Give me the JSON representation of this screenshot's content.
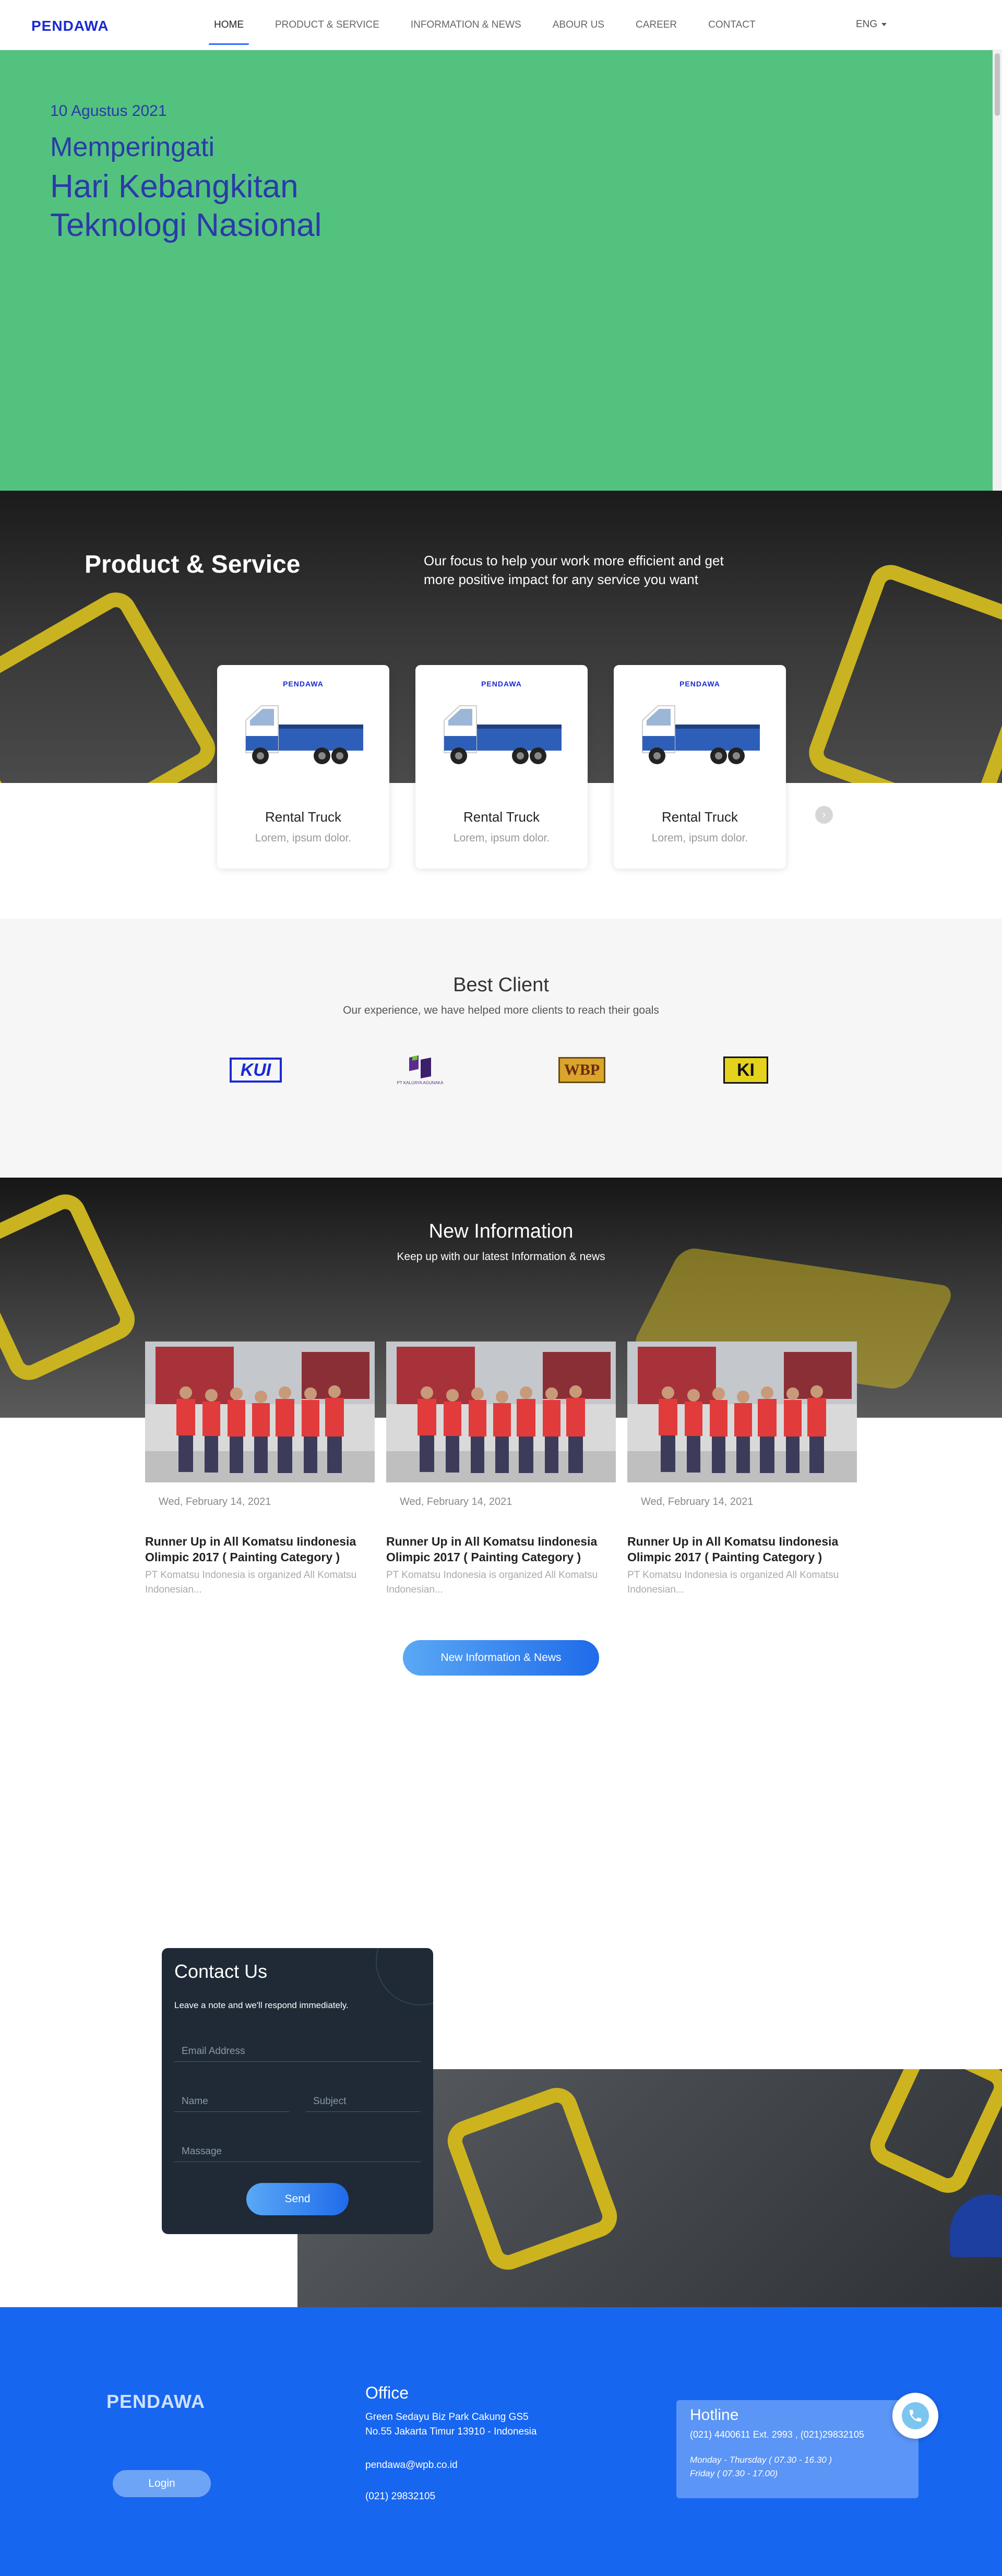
{
  "brand": {
    "logo_text": "PENDAWA"
  },
  "nav": {
    "items": [
      {
        "label": "HOME",
        "active": true
      },
      {
        "label": "PRODUCT & SERVICE",
        "active": false
      },
      {
        "label": "INFORMATION & NEWS",
        "active": false
      },
      {
        "label": "ABOUR US",
        "active": false
      },
      {
        "label": "CAREER",
        "active": false
      },
      {
        "label": "CONTACT",
        "active": false
      }
    ],
    "language": "ENG"
  },
  "hero": {
    "date": "10 Agustus 2021",
    "line1": "Memperingati",
    "line2": "Hari Kebangkitan",
    "line3": "Teknologi Nasional",
    "bg_color": "#53c27f",
    "text_color": "#2b3aa8"
  },
  "product": {
    "title": "Product & Service",
    "description": "Our focus to help your work more efficient and get more positive impact for any service you want",
    "cards": [
      {
        "brand": "PENDAWA",
        "title": "Rental Truck",
        "subtitle": "Lorem, ipsum dolor."
      },
      {
        "brand": "PENDAWA",
        "title": "Rental Truck",
        "subtitle": "Lorem, ipsum dolor."
      },
      {
        "brand": "PENDAWA",
        "title": "Rental Truck",
        "subtitle": "Lorem, ipsum dolor."
      }
    ]
  },
  "clients": {
    "title": "Best Client",
    "subtitle": "Our experience, we have helped more clients to reach their goals",
    "logos": [
      {
        "text": "KUI"
      },
      {
        "text": "PT KALIJAYA AGUNAKA"
      },
      {
        "text": "WBP"
      },
      {
        "text": "KI"
      }
    ]
  },
  "news": {
    "title": "New Information",
    "subtitle": "Keep up with our latest Information & news",
    "items": [
      {
        "date": "Wed, February 14, 2021",
        "headline": "Runner Up in All Komatsu Iindonesia Olimpic 2017 ( Painting Category )",
        "excerpt": "PT Komatsu Indonesia is organized All Komatsu Indonesian..."
      },
      {
        "date": "Wed, February 14, 2021",
        "headline": "Runner Up in All Komatsu Iindonesia Olimpic 2017 ( Painting Category )",
        "excerpt": "PT Komatsu Indonesia is organized All Komatsu Indonesian..."
      },
      {
        "date": "Wed, February 14, 2021",
        "headline": "Runner Up in All Komatsu Iindonesia Olimpic 2017 ( Painting Category )",
        "excerpt": "PT Komatsu Indonesia is organized All Komatsu Indonesian..."
      }
    ],
    "button_label": "New Information & News"
  },
  "contact": {
    "title": "Contact Us",
    "note": "Leave a note and we'll respond immediately.",
    "email_placeholder": "Email Address",
    "name_placeholder": "Name",
    "subject_placeholder": "Subject",
    "message_placeholder": "Massage",
    "send_label": "Send"
  },
  "footer": {
    "logo_text": "PENDAWA",
    "login_label": "Login",
    "office_title": "Office",
    "address_line1": "Green Sedayu Biz Park Cakung GS5",
    "address_line2": "No.55 Jakarta Timur 13910 - Indonesia",
    "email": "pendawa@wpb.co.id",
    "phone": "(021) 29832105",
    "hotline_title": "Hotline",
    "hotline_numbers": "(021) 4400611 Ext. 2993 , (021)29832105",
    "hours_line1": "Monday - Thursday ( 07.30 - 16.30 )",
    "hours_line2": "Friday ( 07.30 - 17.00)"
  }
}
